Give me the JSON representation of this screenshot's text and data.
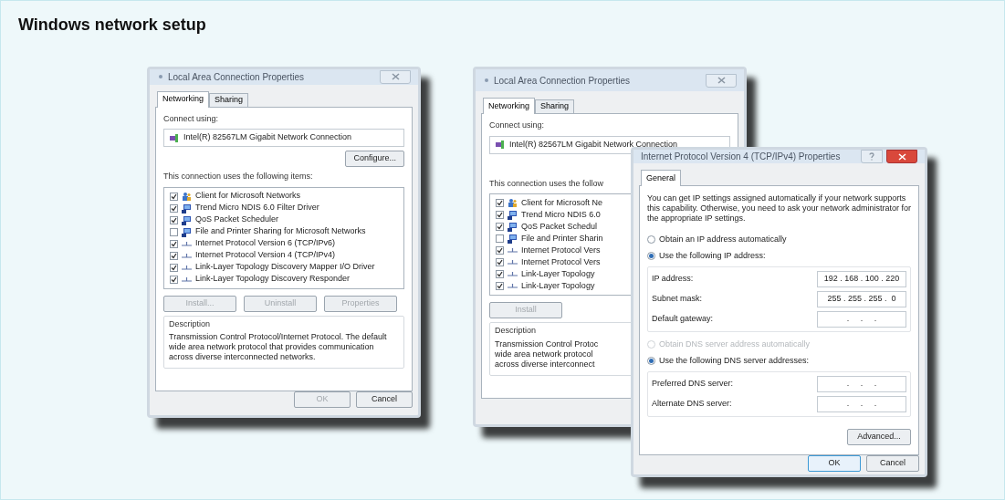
{
  "page": {
    "title": "Windows network setup"
  },
  "windows": [
    {
      "kind": "connection",
      "title": "Local Area Connection Properties",
      "close": true,
      "tabs": [
        {
          "label": "Networking",
          "selected": true
        },
        {
          "label": "Sharing",
          "selected": false
        }
      ],
      "connect_using_label": "Connect using:",
      "adapter": "Intel(R) 82567LM Gigabit Network Connection",
      "configure_button": "Configure...",
      "items_label": "This connection uses the following items:",
      "items": [
        {
          "kind": "client",
          "label": "Client for Microsoft Networks",
          "checked": true
        },
        {
          "kind": "service",
          "label": "Trend Micro NDIS 6.0 Filter Driver",
          "checked": true
        },
        {
          "kind": "service",
          "label": "QoS Packet Scheduler",
          "checked": true
        },
        {
          "kind": "service",
          "label": "File and Printer Sharing for Microsoft Networks",
          "checked": false
        },
        {
          "kind": "protocol",
          "label": "Internet Protocol Version 6 (TCP/IPv6)",
          "checked": true
        },
        {
          "kind": "protocol",
          "label": "Internet Protocol Version 4 (TCP/IPv4)",
          "checked": true
        },
        {
          "kind": "protocol",
          "label": "Link-Layer Topology Discovery Mapper I/O Driver",
          "checked": true
        },
        {
          "kind": "protocol",
          "label": "Link-Layer Topology Discovery Responder",
          "checked": true
        }
      ],
      "buttons": [
        {
          "label": "Install...",
          "disabled": true
        },
        {
          "label": "Uninstall",
          "disabled": true
        },
        {
          "label": "Properties",
          "disabled": true
        }
      ],
      "description_label": "Description",
      "description_lines": [
        "Transmission Control Protocol/Internet Protocol. The default",
        "wide area network protocol that provides communication",
        "across diverse interconnected networks."
      ],
      "footer_buttons": [
        {
          "label": "OK",
          "disabled": true
        },
        {
          "label": "Cancel",
          "disabled": false
        }
      ]
    },
    {
      "kind": "connection",
      "title": "Local Area Connection Properties",
      "close": true,
      "tabs": [
        {
          "label": "Networking",
          "selected": true
        },
        {
          "label": "Sharing",
          "selected": false
        }
      ],
      "connect_using_label": "Connect using:",
      "adapter": "Intel(R) 82567LM Gigabit Network Connection",
      "items_label": "This connection uses the follow",
      "items": [
        {
          "kind": "client",
          "label": "Client for Microsoft Ne",
          "checked": true
        },
        {
          "kind": "service",
          "label": "Trend Micro NDIS 6.0",
          "checked": true
        },
        {
          "kind": "service",
          "label": "QoS Packet Schedul",
          "checked": true
        },
        {
          "kind": "service",
          "label": "File and Printer Sharin",
          "checked": false
        },
        {
          "kind": "protocol",
          "label": "Internet Protocol Vers",
          "checked": true
        },
        {
          "kind": "protocol",
          "label": "Internet Protocol Vers",
          "checked": true
        },
        {
          "kind": "protocol",
          "label": "Link-Layer Topology",
          "checked": true
        },
        {
          "kind": "protocol",
          "label": "Link-Layer Topology",
          "checked": true
        }
      ],
      "buttons": [
        {
          "label": "Install",
          "disabled": true
        }
      ],
      "description_label": "Description",
      "description_lines": [
        "Transmission Control Protoc",
        "wide area network protocol",
        "across diverse interconnect"
      ]
    },
    {
      "kind": "ipv4",
      "title": "Internet Protocol Version 4 (TCP/IPv4) Properties",
      "help": true,
      "close": true,
      "tabs": [
        {
          "label": "General",
          "selected": true
        }
      ],
      "intro": "You can get IP settings assigned automatically if your network supports this capability. Otherwise, you need to ask your network administrator for the appropriate IP settings.",
      "ip_options": [
        {
          "label": "Obtain an IP address automatically",
          "selected": false,
          "disabled": false
        },
        {
          "label": "Use the following IP address:",
          "selected": true,
          "disabled": false
        }
      ],
      "ip_fields": [
        {
          "label": "IP address:",
          "value": "192 . 168 . 100 . 220"
        },
        {
          "label": "Subnet mask:",
          "value": "255 . 255 . 255 .  0"
        },
        {
          "label": "Default gateway:",
          "value": " .     .     . "
        }
      ],
      "dns_options": [
        {
          "label": "Obtain DNS server address automatically",
          "selected": false,
          "disabled": true
        },
        {
          "label": "Use the following DNS server addresses:",
          "selected": true,
          "disabled": false
        }
      ],
      "dns_fields": [
        {
          "label": "Preferred DNS server:",
          "value": " .     .     . "
        },
        {
          "label": "Alternate DNS server:",
          "value": " .     .     . "
        }
      ],
      "advanced_button": "Advanced...",
      "footer_buttons": [
        {
          "label": "OK",
          "default": true
        },
        {
          "label": "Cancel",
          "default": false
        }
      ]
    }
  ]
}
